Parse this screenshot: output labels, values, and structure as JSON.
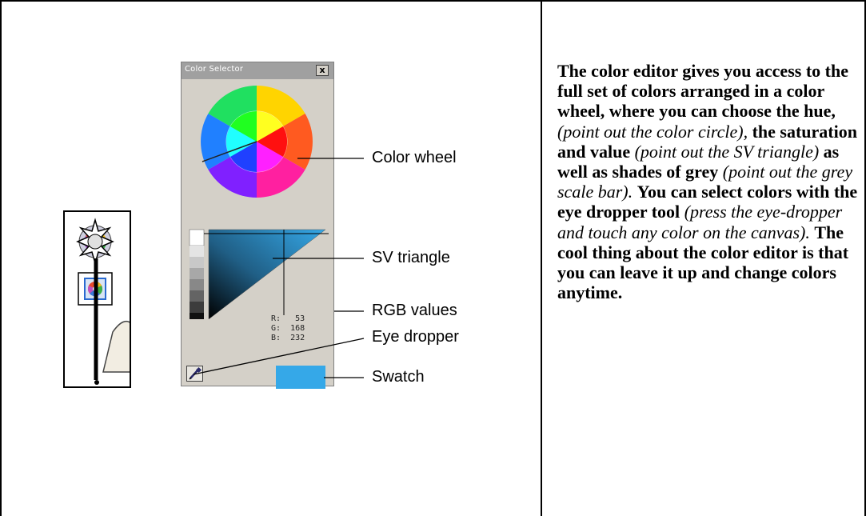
{
  "color_selector": {
    "title": "Color Selector",
    "close_label": "x",
    "rgb": {
      "r_label": "R:",
      "r": "53",
      "g_label": "G:",
      "g": "168",
      "b_label": "B:",
      "b": "232"
    },
    "swatch_color": "#35a8e8"
  },
  "callouts": {
    "color_wheel": "Color wheel",
    "sv_triangle": "SV triangle",
    "rgb_values": "RGB values",
    "eye_dropper": "Eye dropper",
    "swatch": "Swatch"
  },
  "description": {
    "s1": "The color editor gives you access to the full set of colors arranged in a color wheel, where you can choose the hue,",
    "i1": "(point out the color circle),",
    "s2": "the saturation and value",
    "i2": "(point out the SV triangle)",
    "s3": "as well as shades of grey",
    "i3": "(point out the grey scale bar).",
    "s4": "You can select colors with the eye dropper tool",
    "i4": "(press the eye-dropper and touch any color on the canvas).",
    "s5": "The cool thing about the color editor is that you can leave it up and change colors anytime."
  }
}
